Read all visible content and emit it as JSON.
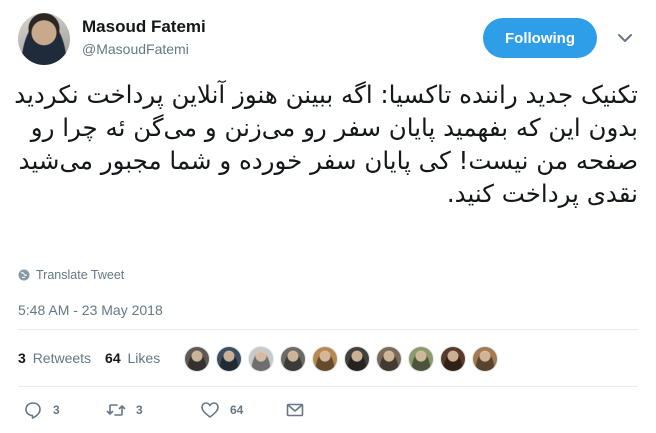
{
  "author": {
    "name": "Masoud Fatemi",
    "handle": "@MasoudFatemi"
  },
  "follow_button": {
    "label": "Following"
  },
  "tweet": {
    "text": "تکنیک جدید راننده تاکسیا: اگه ببینن هنوز آنلاین پرداخت نکردید بدون این که بفهمید پایان سفر رو می‌زنن و می‌گن ئه چرا رو صفحه من نیست! کی پایان سفر خورده و شما مجبور می‌شید نقدی پرداخت کنید."
  },
  "translate": {
    "label": "Translate Tweet",
    "icon": "globe-icon"
  },
  "timestamp": "5:48 AM - 23 May 2018",
  "stats": {
    "retweets_count": "3",
    "retweets_label": "Retweets",
    "likes_count": "64",
    "likes_label": "Likes"
  },
  "likers": [
    {
      "color": "#5f5a55"
    },
    {
      "color": "#3d4e5e"
    },
    {
      "color": "#c9c9c9"
    },
    {
      "color": "#6c6a65"
    },
    {
      "color": "#b8894f"
    },
    {
      "color": "#42403e"
    },
    {
      "color": "#7a6a5a"
    },
    {
      "color": "#8a9a6a"
    },
    {
      "color": "#5a3a2a"
    },
    {
      "color": "#a47a52"
    }
  ],
  "actions": {
    "reply_count": "3",
    "retweet_count": "3",
    "like_count": "64"
  },
  "colors": {
    "accent": "#2e9ee8",
    "muted": "#657786",
    "text": "#14171a"
  }
}
